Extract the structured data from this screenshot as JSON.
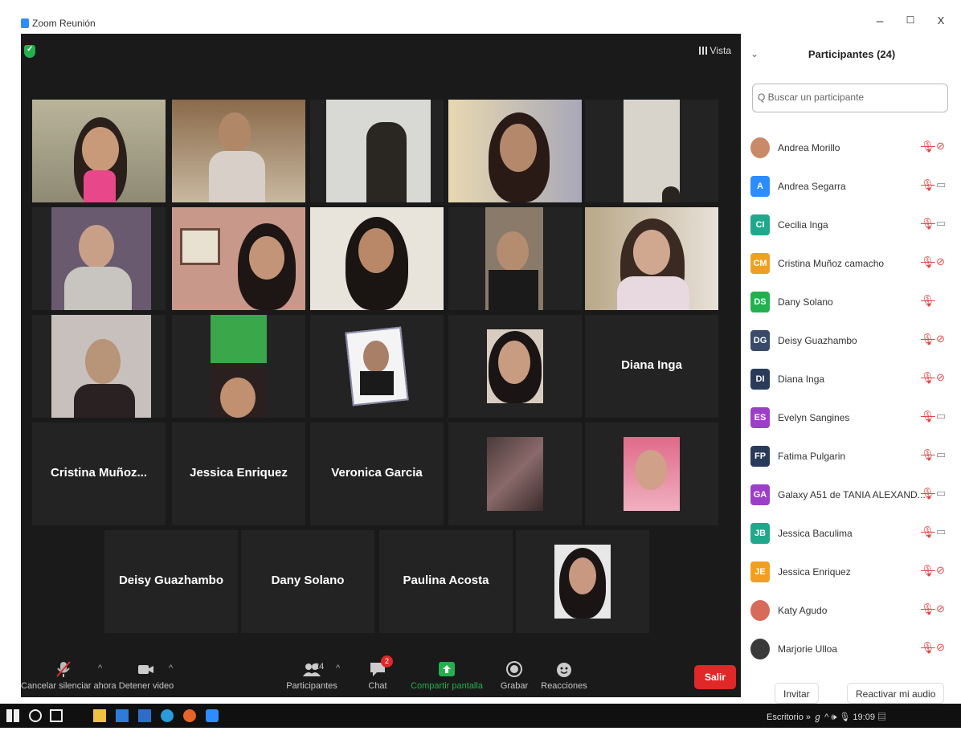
{
  "window": {
    "title": "Zoom Reunión",
    "minimize": "–",
    "maximize": "☐",
    "close": "X"
  },
  "meeting": {
    "view_label": "Vista"
  },
  "tiles": {
    "diana": "Diana Inga",
    "cristina": "Cristina  Muñoz...",
    "jessica": "Jessica Enriquez",
    "veronica": "Veronica Garcia",
    "deisy": "Deisy Guazhambo",
    "dany": "Dany Solano",
    "paulina": "Paulina Acosta"
  },
  "toolbar": {
    "mute_label": "Cancelar silenciar ahora",
    "video_label": "Detener video",
    "participants_label": "Participantes",
    "participants_count": "24",
    "chat_label": "Chat",
    "chat_badge": "2",
    "share_label": "Compartir pantalla",
    "record_label": "Grabar",
    "reactions_label": "Reacciones",
    "leave_label": "Salir"
  },
  "panel": {
    "title": "Participantes (24)",
    "search_placeholder": "Buscar un participante",
    "invite_label": "Invitar",
    "unmute_label": "Reactivar mi audio",
    "participants": [
      {
        "name": "Andrea Morillo",
        "initials": "",
        "color": "#c98a6a",
        "mic": "off",
        "cam": "off"
      },
      {
        "name": "Andrea Segarra",
        "initials": "A",
        "color": "#2d8cff",
        "mic": "off",
        "cam": "on"
      },
      {
        "name": "Cecilia Inga",
        "initials": "CI",
        "color": "#1fa88c",
        "mic": "off",
        "cam": "on"
      },
      {
        "name": "Cristina Muñoz camacho",
        "initials": "CM",
        "color": "#f0a020",
        "mic": "off",
        "cam": "off"
      },
      {
        "name": "Dany Solano",
        "initials": "DS",
        "color": "#23b04e",
        "mic": "off",
        "cam": "none"
      },
      {
        "name": "Deisy Guazhambo",
        "initials": "DG",
        "color": "#3a4a6a",
        "mic": "off",
        "cam": "off"
      },
      {
        "name": "Diana Inga",
        "initials": "DI",
        "color": "#2a3a5a",
        "mic": "off",
        "cam": "off"
      },
      {
        "name": "Evelyn Sangines",
        "initials": "ES",
        "color": "#9b3fc8",
        "mic": "off",
        "cam": "on"
      },
      {
        "name": "Fatima Pulgarin",
        "initials": "FP",
        "color": "#2a3a5a",
        "mic": "off",
        "cam": "on"
      },
      {
        "name": "Galaxy A51 de TANIA ALEXAND...",
        "initials": "GA",
        "color": "#9b3fc8",
        "mic": "off",
        "cam": "on"
      },
      {
        "name": "Jessica Baculima",
        "initials": "JB",
        "color": "#1fa88c",
        "mic": "off",
        "cam": "on"
      },
      {
        "name": "Jessica Enriquez",
        "initials": "JE",
        "color": "#f0a020",
        "mic": "off",
        "cam": "off"
      },
      {
        "name": "Katy Agudo",
        "initials": "",
        "color": "#d86a5a",
        "mic": "off",
        "cam": "off"
      },
      {
        "name": "Marjorie Ulloa",
        "initials": "",
        "color": "#3a3a3a",
        "mic": "off",
        "cam": "off"
      }
    ]
  },
  "taskbar": {
    "desktop_label": "Escritorio",
    "time": "19:09"
  }
}
